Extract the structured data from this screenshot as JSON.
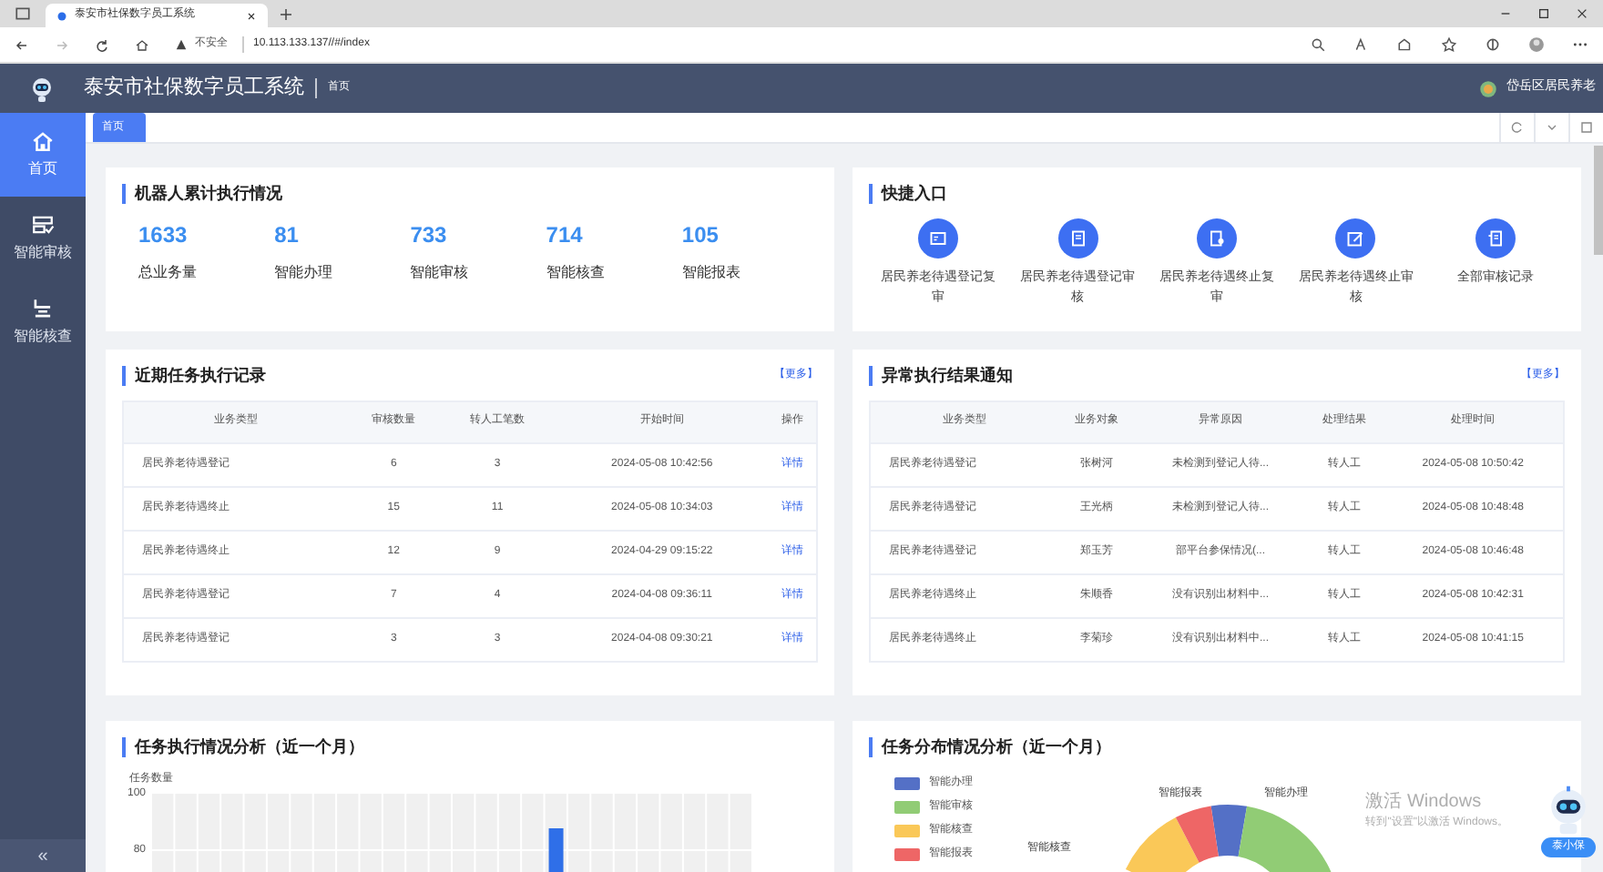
{
  "browser": {
    "tab_title": "泰安市社保数字员工系统",
    "security": "不安全",
    "url": "10.113.133.137//#/index"
  },
  "header": {
    "title": "泰安市社保数字员工系统",
    "breadcrumb": "首页",
    "user": "岱岳区居民养老"
  },
  "sidebar": {
    "items": [
      {
        "label": "首页",
        "selected": true,
        "kind": "home"
      },
      {
        "label": "智能审核",
        "selected": false,
        "kind": "audit"
      },
      {
        "label": "智能核查",
        "selected": false,
        "kind": "check"
      }
    ],
    "collapse": "«"
  },
  "tabs": [
    {
      "label": "首页",
      "selected": true
    }
  ],
  "stats": {
    "title": "机器人累计执行情况",
    "items": [
      {
        "value": "1633",
        "label": "总业务量"
      },
      {
        "value": "81",
        "label": "智能办理"
      },
      {
        "value": "733",
        "label": "智能审核"
      },
      {
        "value": "714",
        "label": "智能核查"
      },
      {
        "value": "105",
        "label": "智能报表"
      }
    ]
  },
  "shortcuts": {
    "title": "快捷入口",
    "items": [
      {
        "label": "居民养老待遇登记复审"
      },
      {
        "label": "居民养老待遇登记审核"
      },
      {
        "label": "居民养老待遇终止复审"
      },
      {
        "label": "居民养老待遇终止审核"
      },
      {
        "label": "全部审核记录"
      }
    ]
  },
  "tasks": {
    "title": "近期任务执行记录",
    "more": "【更多】",
    "columns": [
      "业务类型",
      "审核数量",
      "转人工笔数",
      "开始时间",
      "操作"
    ],
    "rows": [
      [
        "居民养老待遇登记",
        "6",
        "3",
        "2024-05-08 10:42:56",
        "详情"
      ],
      [
        "居民养老待遇终止",
        "15",
        "11",
        "2024-05-08 10:34:03",
        "详情"
      ],
      [
        "居民养老待遇终止",
        "12",
        "9",
        "2024-04-29 09:15:22",
        "详情"
      ],
      [
        "居民养老待遇登记",
        "7",
        "4",
        "2024-04-08 09:36:11",
        "详情"
      ],
      [
        "居民养老待遇登记",
        "3",
        "3",
        "2024-04-08 09:30:21",
        "详情"
      ]
    ]
  },
  "anomalies": {
    "title": "异常执行结果通知",
    "more": "【更多】",
    "columns": [
      "业务类型",
      "业务对象",
      "异常原因",
      "处理结果",
      "处理时间"
    ],
    "rows": [
      [
        "居民养老待遇登记",
        "张树河",
        "未检测到登记人待...",
        "转人工",
        "2024-05-08 10:50:42"
      ],
      [
        "居民养老待遇登记",
        "王光柄",
        "未检测到登记人待...",
        "转人工",
        "2024-05-08 10:48:48"
      ],
      [
        "居民养老待遇登记",
        "郑玉芳",
        "部平台参保情况(...",
        "转人工",
        "2024-05-08 10:46:48"
      ],
      [
        "居民养老待遇终止",
        "朱顺香",
        "没有识别出材料中...",
        "转人工",
        "2024-05-08 10:42:31"
      ],
      [
        "居民养老待遇终止",
        "李菊珍",
        "没有识别出材料中...",
        "转人工",
        "2024-05-08 10:41:15"
      ]
    ]
  },
  "task_chart": {
    "title": "任务执行情况分析（近一个月）",
    "axis_title": "任务数量",
    "tick_labels": [
      "100",
      "80"
    ]
  },
  "distribution": {
    "title": "任务分布情况分析（近一个月）",
    "legend": [
      {
        "label": "智能办理",
        "color": "#5470c6"
      },
      {
        "label": "智能审核",
        "color": "#91cc75"
      },
      {
        "label": "智能核查",
        "color": "#fac858"
      },
      {
        "label": "智能报表",
        "color": "#ee6666"
      }
    ],
    "slice_labels": [
      "智能报表",
      "智能办理",
      "智能核查"
    ]
  },
  "assistant": {
    "label": "泰小保"
  },
  "os_notice": {
    "title": "激活 Windows",
    "subtitle": "转到\"设置\"以激活 Windows。"
  }
}
